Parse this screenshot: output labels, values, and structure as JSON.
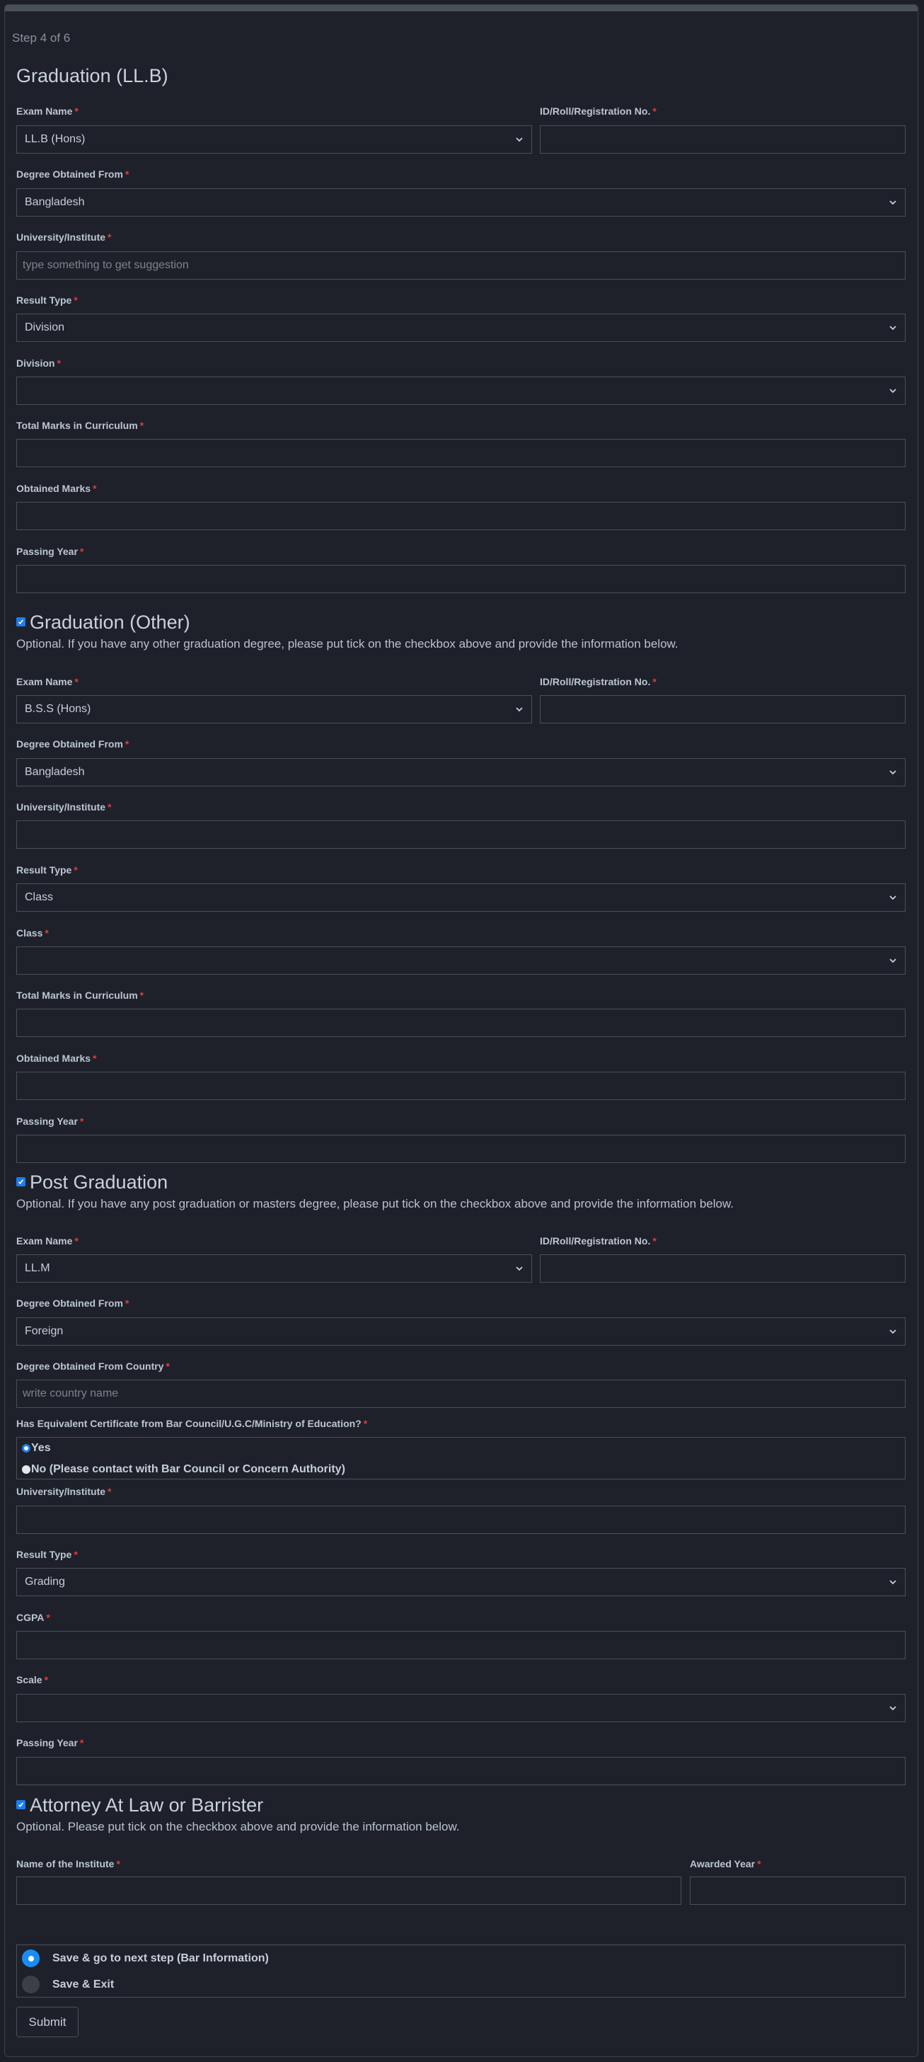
{
  "step": "Step 4 of 6",
  "required_mark": "*",
  "graduation_llb": {
    "title": "Graduation (LL.B)",
    "exam_name": {
      "label": "Exam Name",
      "value": "LL.B (Hons)"
    },
    "id_roll": {
      "label": "ID/Roll/Registration No.",
      "value": ""
    },
    "degree_from": {
      "label": "Degree Obtained From",
      "value": "Bangladesh"
    },
    "university": {
      "label": "University/Institute",
      "placeholder": "type something to get suggestion"
    },
    "result_type": {
      "label": "Result Type",
      "value": "Division"
    },
    "division": {
      "label": "Division",
      "value": ""
    },
    "total_marks": {
      "label": "Total Marks in Curriculum",
      "value": ""
    },
    "obtained_marks": {
      "label": "Obtained Marks",
      "value": ""
    },
    "passing_year": {
      "label": "Passing Year",
      "value": ""
    }
  },
  "graduation_other": {
    "checked": true,
    "title": "Graduation (Other)",
    "description": "Optional. If you have any other graduation degree, please put tick on the checkbox above and provide the information below.",
    "exam_name": {
      "label": "Exam Name",
      "value": "B.S.S (Hons)"
    },
    "id_roll": {
      "label": "ID/Roll/Registration No.",
      "value": ""
    },
    "degree_from": {
      "label": "Degree Obtained From",
      "value": "Bangladesh"
    },
    "university": {
      "label": "University/Institute",
      "value": ""
    },
    "result_type": {
      "label": "Result Type",
      "value": "Class"
    },
    "class": {
      "label": "Class",
      "value": ""
    },
    "total_marks": {
      "label": "Total Marks in Curriculum",
      "value": ""
    },
    "obtained_marks": {
      "label": "Obtained Marks",
      "value": ""
    },
    "passing_year": {
      "label": "Passing Year",
      "value": ""
    }
  },
  "post_graduation": {
    "checked": true,
    "title": "Post Graduation",
    "description": "Optional. If you have any post graduation or masters degree, please put tick on the checkbox above and provide the information below.",
    "exam_name": {
      "label": "Exam Name",
      "value": "LL.M"
    },
    "id_roll": {
      "label": "ID/Roll/Registration No.",
      "value": ""
    },
    "degree_from": {
      "label": "Degree Obtained From",
      "value": "Foreign"
    },
    "country": {
      "label": "Degree Obtained From Country",
      "placeholder": "write country name"
    },
    "equivalent": {
      "label": "Has Equivalent Certificate from Bar Council/U.G.C/Ministry of Education?",
      "options": [
        "Yes",
        "No (Please contact with Bar Council or Concern Authority)"
      ],
      "selected": "Yes"
    },
    "university": {
      "label": "University/Institute",
      "value": ""
    },
    "result_type": {
      "label": "Result Type",
      "value": "Grading"
    },
    "cgpa": {
      "label": "CGPA",
      "value": ""
    },
    "scale": {
      "label": "Scale",
      "value": ""
    },
    "passing_year": {
      "label": "Passing Year",
      "value": ""
    }
  },
  "attorney": {
    "checked": true,
    "title": "Attorney At Law or Barrister",
    "description": "Optional. Please put tick on the checkbox above and provide the information below.",
    "institute": {
      "label": "Name of the Institute",
      "value": ""
    },
    "awarded_year": {
      "label": "Awarded Year",
      "value": ""
    }
  },
  "save_options": {
    "options": [
      "Save & go to next step (Bar Information)",
      "Save & Exit"
    ],
    "selected": "Save & go to next step (Bar Information)"
  },
  "submit_label": "Submit",
  "colors": {
    "accent": "#1a8df5",
    "required": "#e03a3e",
    "background": "#1e2129",
    "border": "#4a4f57"
  }
}
